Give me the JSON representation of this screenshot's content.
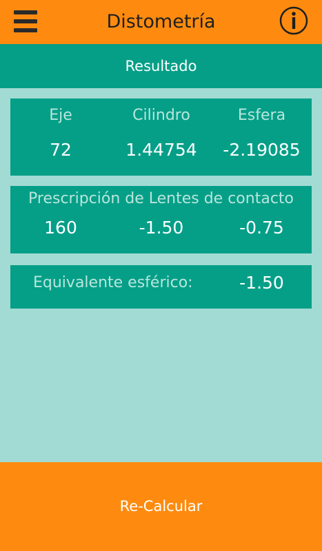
{
  "colors": {
    "header_bg": "#fe8b0f",
    "section_bg": "#059f88",
    "page_bg": "#a2dbd3",
    "button_bg": "#fe8b0f",
    "label_text": "#b9e6dc",
    "value_text": "#ffffff"
  },
  "header": {
    "title": "Distometría",
    "menu_icon": "hamburger-menu-icon",
    "info_icon": "info-icon"
  },
  "section": {
    "title": "Resultado"
  },
  "results": {
    "eje_label": "Eje",
    "cilindro_label": "Cilindro",
    "esfera_label": "Esfera",
    "eje_value": "72",
    "cilindro_value": "1.44754",
    "esfera_value": "-2.19085"
  },
  "contact_lens": {
    "title": "Prescripción de Lentes de contacto",
    "value_1": "160",
    "value_2": "-1.50",
    "value_3": "-0.75"
  },
  "equivalent": {
    "label": "Equivalente esférico:",
    "value": "-1.50"
  },
  "recalculate": {
    "label": "Re-Calcular"
  }
}
